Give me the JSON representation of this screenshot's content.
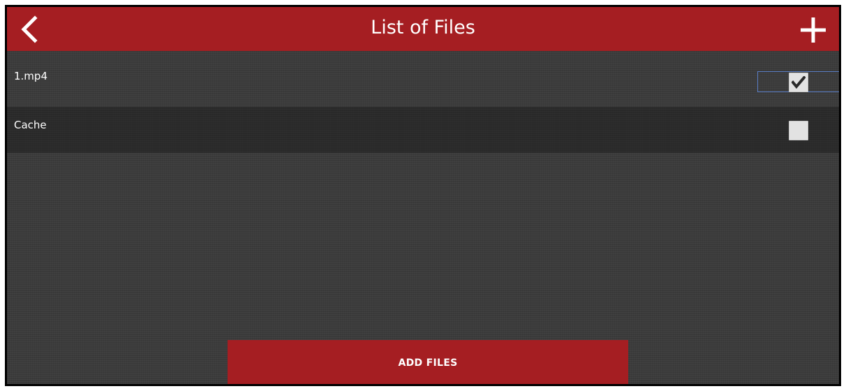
{
  "header": {
    "title": "List of Files",
    "back_icon": "chevron-left-icon",
    "add_icon": "plus-icon",
    "background_color": "#a51e22"
  },
  "files": [
    {
      "name": "1.mp4",
      "checked": true,
      "focused": true
    },
    {
      "name": "Cache",
      "checked": false,
      "focused": false
    }
  ],
  "footer": {
    "add_files_label": "ADD FILES"
  },
  "colors": {
    "accent": "#a51e22",
    "background": "#3b3b3b",
    "focus_outline": "#5b7ec6",
    "checkbox_fill": "#e2e2e2"
  }
}
